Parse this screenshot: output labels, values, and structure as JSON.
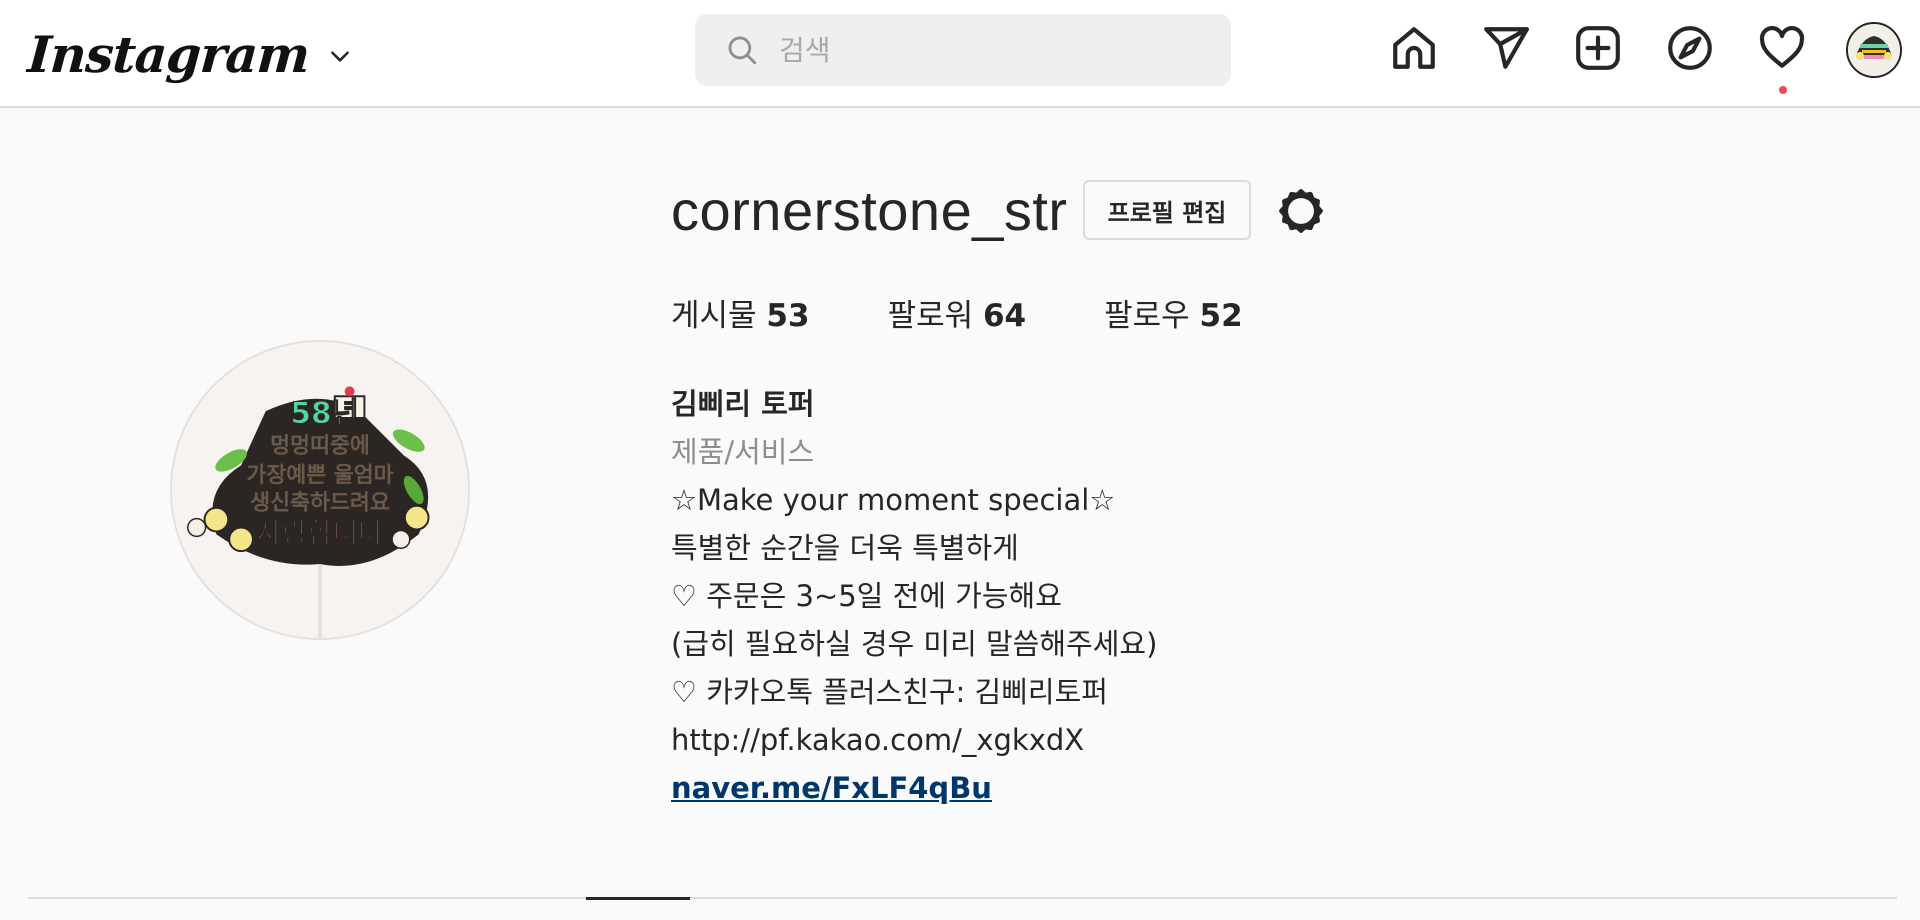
{
  "header": {
    "logo_text": "Instagram",
    "search": {
      "placeholder": "검색",
      "value": ""
    },
    "nav_icons": [
      "home-icon",
      "direct-message-icon",
      "new-post-icon",
      "explore-icon",
      "activity-heart-icon",
      "profile-avatar"
    ],
    "notification_dot_color": "#ed4956"
  },
  "profile": {
    "username": "cornerstone_str",
    "edit_button_label": "프로필 편집",
    "stats": [
      {
        "label": "게시물",
        "value": "53"
      },
      {
        "label": "팔로워",
        "value": "64"
      },
      {
        "label": "팔로우",
        "value": "52"
      }
    ],
    "bio": {
      "name": "김삐리 토퍼",
      "category": "제품/서비스",
      "lines": [
        "☆Make your moment special☆",
        "특별한 순간을 더욱 특별하게",
        "♡ 주문은 3~5일 전에 가능해요",
        "(급히 필요하실 경우 미리 말씀해주세요)",
        "♡ 카카오톡 플러스친구: 김삐리토퍼",
        "http://pf.kakao.com/_xgkxdX"
      ],
      "link": "naver.me/FxLF4qBu"
    },
    "avatar_topper_text": [
      "58년",
      "멍멍띠중에",
      "가장예쁜 울엄마",
      "생신축하드려요",
      "사랑합니다"
    ]
  },
  "colors": {
    "background": "#fafafa",
    "link": "#00376b",
    "muted_text": "#8e8e8e",
    "border": "#dbdbdb"
  }
}
